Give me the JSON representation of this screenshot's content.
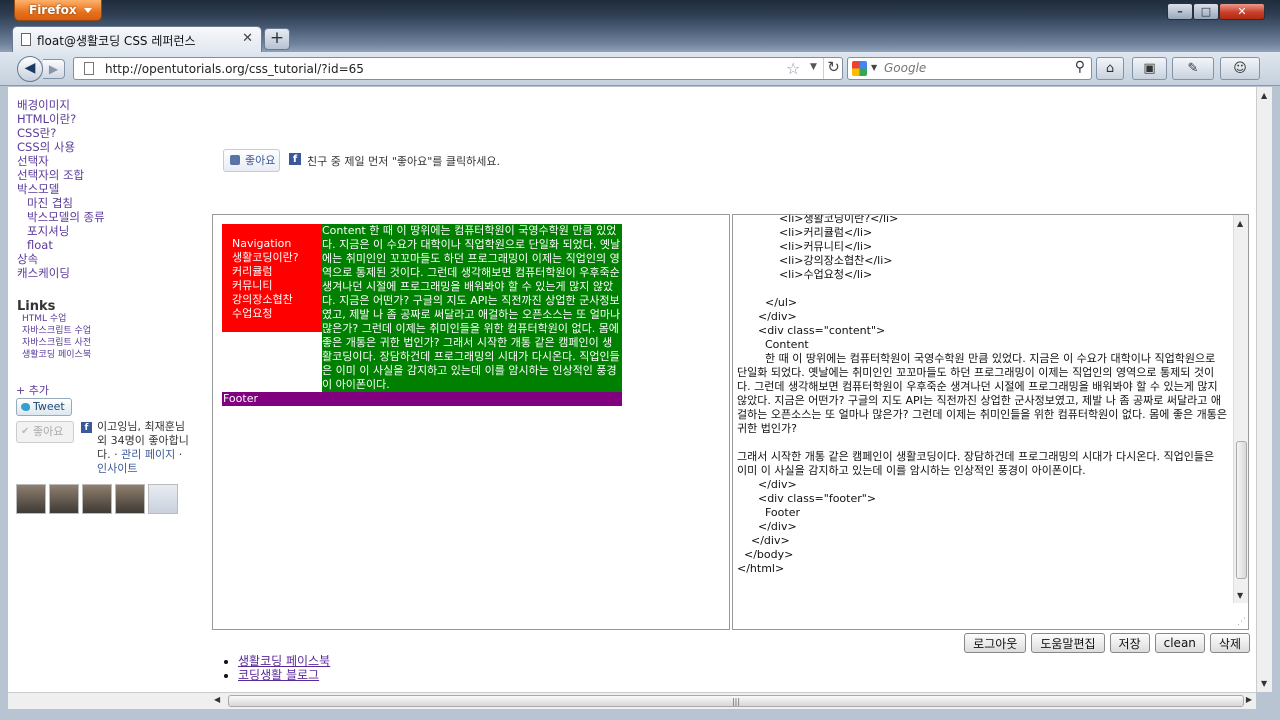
{
  "browser": {
    "app_button": "Firefox",
    "tab_title": "float@생활코딩 CSS 레퍼런스",
    "new_tab": "+",
    "url": "http://opentutorials.org/css_tutorial/?id=65",
    "search_placeholder": "Google",
    "window_min": "–",
    "window_max": "□",
    "window_close": "✕"
  },
  "sidebar": {
    "nav_items": [
      {
        "label": "배경이미지"
      },
      {
        "label": "HTML이란?"
      },
      {
        "label": "CSS란?"
      },
      {
        "label": "CSS의 사용"
      },
      {
        "label": "선택자"
      },
      {
        "label": "선택자의 조합"
      },
      {
        "label": "박스모델"
      },
      {
        "label": "마진 겹침"
      },
      {
        "label": "박스모델의 종류"
      },
      {
        "label": "포지셔닝"
      },
      {
        "label": "float"
      },
      {
        "label": "상속"
      },
      {
        "label": "캐스케이딩"
      }
    ],
    "links_title": "Links",
    "links": [
      "HTML 수업",
      "자바스크립트 수업",
      "자바스크립트 사전",
      "생활코딩 페이스북"
    ],
    "add_label": "+ 추가",
    "tweet_label": "Tweet",
    "like_label": "좋아요",
    "friends_text_pre": "이고잉님, 최재훈님 외 34명이 좋아합니다. · ",
    "friends_admin": "관리 페이지",
    "friends_sep": " · ",
    "friends_insight": "인사이트"
  },
  "content": {
    "like_button": "좋아요",
    "like_prompt": "친구 중 제일 먼저 \"좋아요\"를 클릭하세요.",
    "demo": {
      "nav_items": [
        "Navigation",
        "생활코딩이란?",
        "커리큘럼",
        "커뮤니티",
        "강의장소협찬",
        "수업요청"
      ],
      "content": "Content 한 때 이 땅위에는 컴퓨터학원이 국영수학원 만큼 있었다. 지금은 이 수요가 대학이나 직업학원으로 단일화 되었다. 옛날에는 취미인인 꼬꼬마들도 하던 프로그래밍이 이제는 직업인의 영역으로 통제된 것이다. 그런데 생각해보면 컴퓨터학원이 우후죽순 생겨나던 시절에 프로그래밍을 배워봐야 할 수 있는게 많지 않았다. 지금은 어떤가? 구글의 지도 API는 직전까진 상업한 군사정보였고, 제발 나 좀 공짜로 써달라고 애걸하는 오픈소스는 또 얼마나 많은가? 그런데 이제는 취미인들을 위한 컴퓨터학원이 없다. 몸에 좋은 개통은 귀한 법인가? 그래서 시작한 개통 같은 캠페인이 생활코딩이다. 장담하건데 프로그래밍의 시대가 다시온다. 직업인들은 이미 이 사실을 감지하고 있는데 이를 암시하는 인상적인 풍경이 아이폰이다.",
      "footer": "Footer"
    },
    "code": "            <li>생활코딩이란?</li>\n            <li>커리큘럼</li>\n            <li>커뮤니티</li>\n            <li>강의장소협찬</li>\n            <li>수업요청</li>\n\n        </ul>\n      </div>\n      <div class=\"content\">\n        Content\n        한 때 이 땅위에는 컴퓨터학원이 국영수학원 만큼 있었다. 지금은 이 수요가 대학이나 직업학원으로 단일화 되었다. 옛날에는 취미인인 꼬꼬마들도 하던 프로그래밍이 이제는 직업인의 영역으로 통제되 것이다. 그런데 생각해보면 컴퓨터학원이 우후죽순 생겨나던 시절에 프로그래밍을 배워봐야 할 수 있는게 많지 않았다. 지금은 어떤가? 구글의 지도 API는 직전까진 상업한 군사정보였고, 제발 나 좀 공짜로 써달라고 애걸하는 오픈소스는 또 얼마나 많은가? 그런데 이제는 취미인들을 위한 컴퓨터학원이 없다. 몸에 좋은 개통은 귀한 법인가?\n\n그래서 시작한 개통 같은 캠페인이 생활코딩이다. 장담하건데 프로그래밍의 시대가 다시온다. 직업인들은 이미 이 사실을 감지하고 있는데 이를 암시하는 인상적인 풍경이 아이폰이다.\n      </div>\n      <div class=\"footer\">\n        Footer\n      </div>\n    </div>\n  </body>\n</html>",
    "buttons": [
      "로그아웃",
      "도움말편집",
      "저장",
      "clean",
      "삭제"
    ],
    "footer_links": [
      "생활코딩 페이스북",
      "코딩생활 블로그"
    ]
  }
}
